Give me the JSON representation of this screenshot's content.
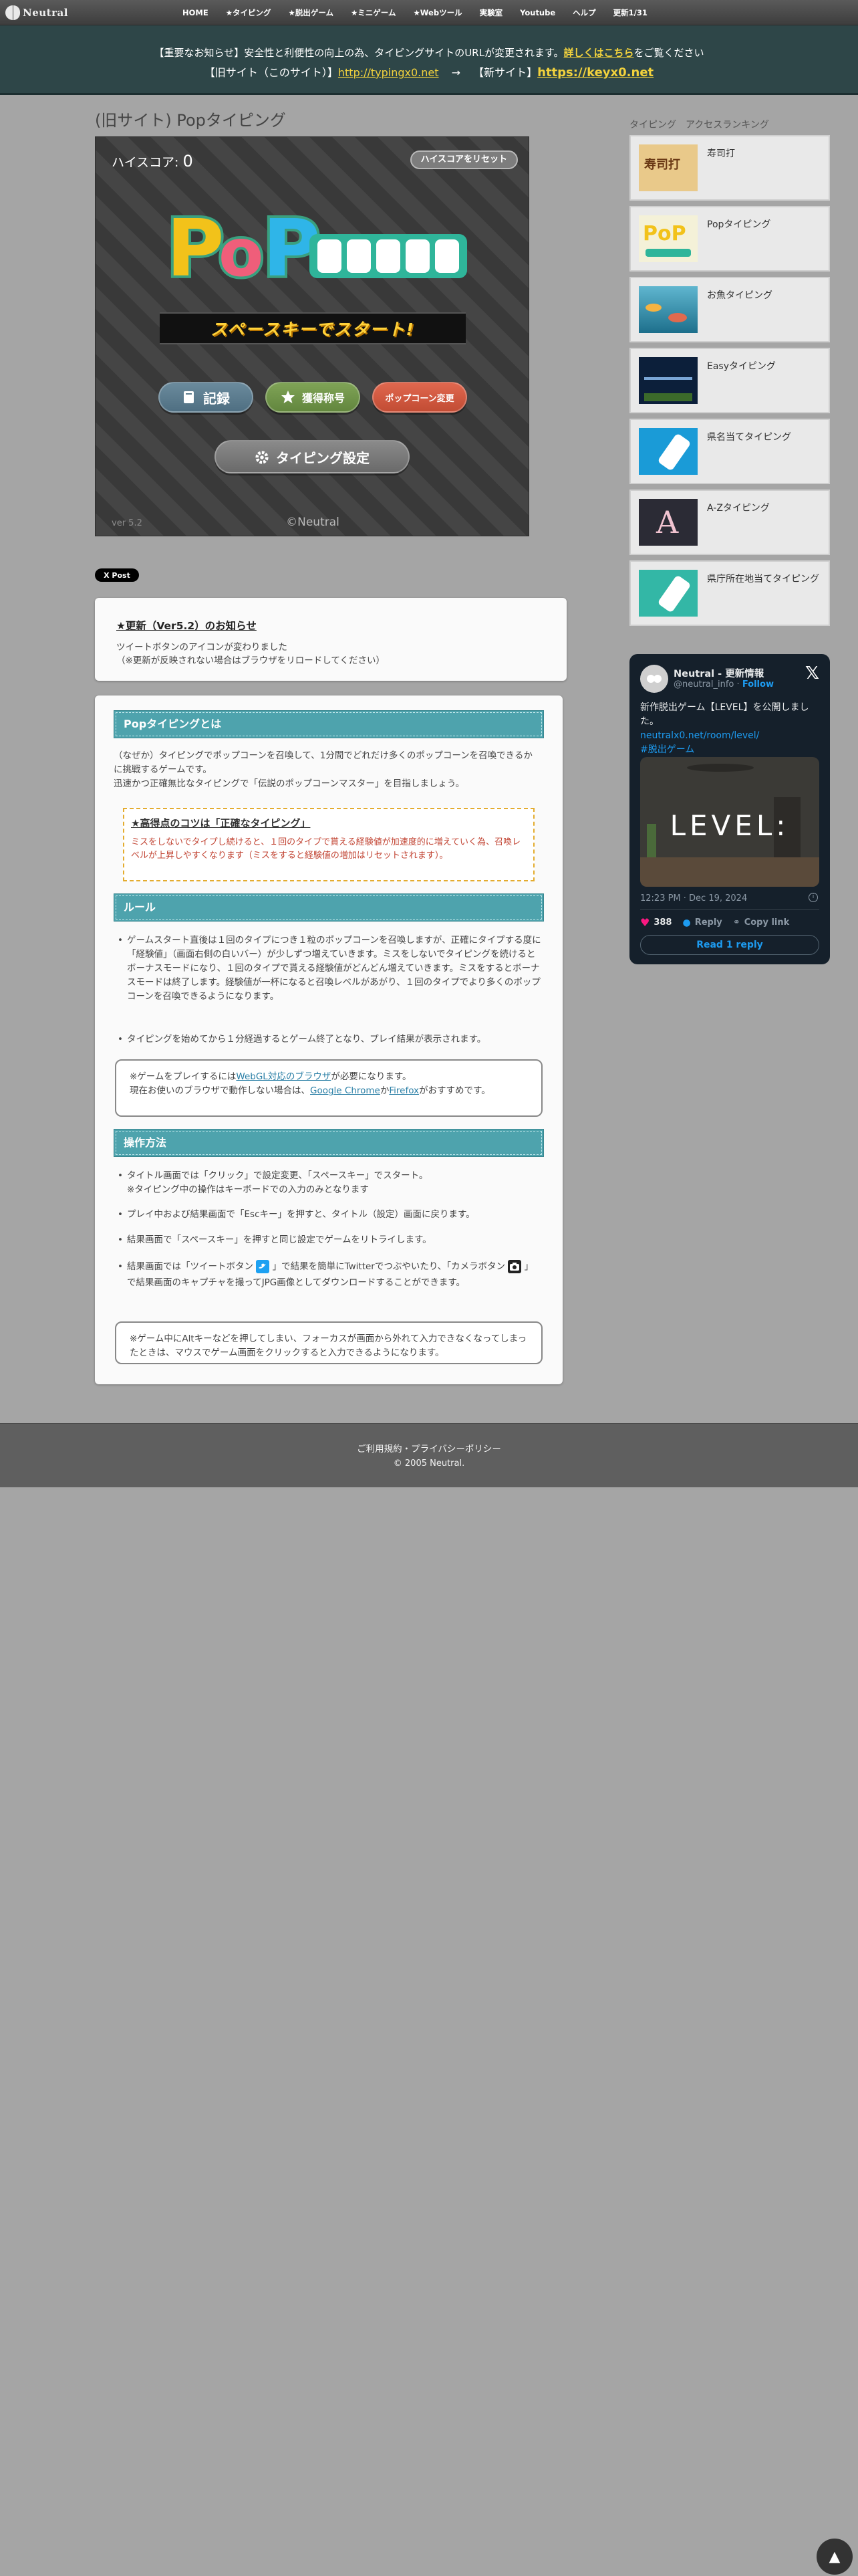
{
  "nav": {
    "logo_text": "Neutral",
    "items": [
      {
        "label": "HOME"
      },
      {
        "label": "★タイピング"
      },
      {
        "label": "★脱出ゲーム"
      },
      {
        "label": "★ミニゲーム"
      },
      {
        "label": "★Webツール"
      },
      {
        "label": "実験室"
      },
      {
        "label": "Youtube"
      },
      {
        "label": "ヘルプ"
      },
      {
        "label": "更新1/31"
      }
    ]
  },
  "notice": {
    "line1_pre": "【重要なお知らせ】安全性と利便性の向上の為、タイピングサイトのURLが変更されます。",
    "line1_link": "詳しくはこちら",
    "line1_post": "をご覧ください",
    "line2_old_label": "【旧サイト（このサイト）】",
    "line2_old_url": "http://typingx0.net",
    "line2_arrow": "→",
    "line2_new_label": "【新サイト】",
    "line2_new_url": "https://keyx0.net"
  },
  "page_title": "(旧サイト) Popタイピング",
  "game": {
    "highscore_label": "ハイスコア:",
    "highscore_value": "0",
    "reset_button": "ハイスコアをリセット",
    "start_text": "スペースキーでスタート!",
    "record_button": "記録",
    "titles_button": "獲得称号",
    "change_button": "ポップコーン変更",
    "settings_button": "タイピング設定",
    "version": "ver 5.2",
    "copyright": "©Neutral"
  },
  "tweet_button": "X Post",
  "update": {
    "title": "★更新（Ver5.2）のお知らせ",
    "line1": "ツイートボタンのアイコンが変わりました",
    "line2": "（※更新が反映されない場合はブラウザをリロードしてください）"
  },
  "main": {
    "sec1_title": "Popタイピングとは",
    "sec1_p1": "（なぜか）タイピングでポップコーンを召喚して、1分間でどれだけ多くのポップコーンを召喚できるかに挑戦するゲームです。",
    "sec1_p2": "迅速かつ正確無比なタイピングで「伝説のポップコーンマスター」を目指しましょう。",
    "tip_title": "★高得点のコツは「正確なタイピング」",
    "tip_body": "ミスをしないでタイプし続けると、１回のタイプで貰える経験値が加速度的に増えていく為、召喚レベルが上昇しやすくなります（ミスをすると経験値の増加はリセットされます）。",
    "sec2_title": "ルール",
    "rule1": "ゲームスタート直後は１回のタイプにつき１粒のポップコーンを召喚しますが、正確にタイプする度に「経験値」（画面右側の白いバー）が少しずつ増えていきます。ミスをしないでタイピングを続けるとボーナスモードになり、１回のタイプで貰える経験値がどんどん増えていきます。ミスをするとボーナスモードは終了します。経験値が一杯になると召喚レベルがあがり、１回のタイプでより多くのポップコーンを召喚できるようになります。",
    "rule2": "タイピングを始めてから１分経過するとゲーム終了となり、プレイ結果が表示されます。",
    "note1_pre": "※ゲームをプレイするには",
    "note1_link1": "WebGL対応のブラウザ",
    "note1_mid": "が必要になります。",
    "note1_line2_pre": "現在お使いのブラウザで動作しない場合は、",
    "note1_link2": "Google Chrome",
    "note1_and": "か",
    "note1_link3": "Firefox",
    "note1_post": "がおすすめです。",
    "sec3_title": "操作方法",
    "op1_a": "タイトル画面では「クリック」で設定変更、「スペースキー」でスタート。",
    "op1_b": "※タイピング中の操作はキーボードでの入力のみとなります",
    "op2": "プレイ中および結果画面で「Escキー」を押すと、タイトル（設定）画面に戻ります。",
    "op3": "結果画面で「スペースキー」を押すと同じ設定でゲームをリトライします。",
    "op4_a": "結果画面では「ツイートボタン",
    "op4_b": "」で結果を簡単にTwitterでつぶやいたり、「カメラボタン",
    "op4_c": "」で結果画面のキャプチャを撮ってJPG画像としてダウンロードすることができます。",
    "note2": "※ゲーム中にAltキーなどを押してしまい、フォーカスが画面から外れて入力できなくなってしまったときは、マウスでゲーム画面をクリックすると入力できるようになります。"
  },
  "sidebar": {
    "title": "タイピング　アクセスランキング",
    "items": [
      {
        "name": "寿司打",
        "thumb_text": "寿司打"
      },
      {
        "name": "Popタイピング",
        "thumb_text": "PoP"
      },
      {
        "name": "お魚タイピング",
        "thumb_text": ""
      },
      {
        "name": "Easyタイピング",
        "thumb_text": ""
      },
      {
        "name": "県名当てタイピング",
        "thumb_text": ""
      },
      {
        "name": "A-Zタイピング",
        "thumb_text": "A"
      },
      {
        "name": "県庁所在地当てタイピング",
        "thumb_text": ""
      }
    ]
  },
  "xpost": {
    "name": "Neutral - 更新情報",
    "handle": "@neutral_info",
    "dot": "·",
    "follow": "Follow",
    "text": "新作脱出ゲーム【LEVEL】を公開しました。",
    "link": "neutralx0.net/room/level/",
    "hashtag": "#脱出ゲーム",
    "image_text": "LEVEL:",
    "time": "12:23 PM · Dec 19, 2024",
    "likes": "388",
    "reply": "Reply",
    "copy_link": "Copy link",
    "read_reply": "Read 1 reply"
  },
  "footer": {
    "links": "ご利用規約・プライバシーポリシー",
    "copyright": "© 2005 Neutral."
  },
  "colors": {
    "section_head": "#4ea3ad",
    "notice_bg": "#2e4648",
    "notice_link": "#f2d23d",
    "tip_border": "#e4ac2f"
  }
}
